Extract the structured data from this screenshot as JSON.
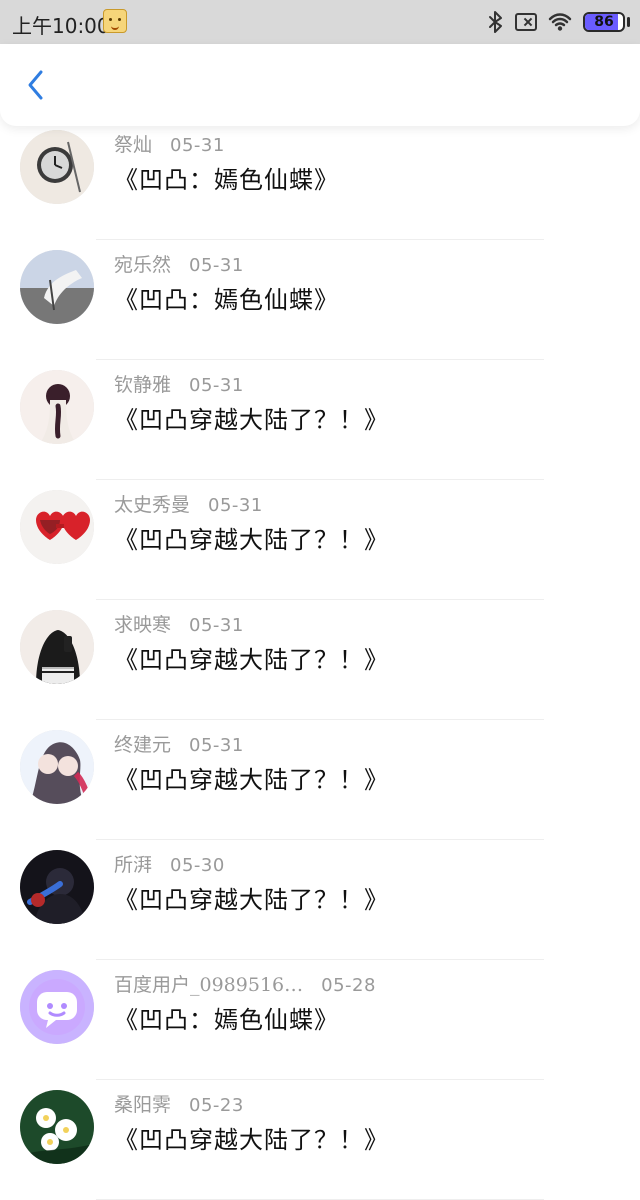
{
  "status_bar": {
    "time": "上午10:00",
    "battery_percent": "86",
    "battery_level": 0.86,
    "colors": {
      "bar_bg": "#d9d9d9",
      "battery_fill": "#6a5cff"
    }
  },
  "header": {
    "back_icon": "chevron-left-icon",
    "accent": "#2f7de1"
  },
  "comments": [
    {
      "name": "祭灿",
      "date": "05-31",
      "title": "《凹凸：嫣色仙蝶》",
      "avatar": "pocket-watch-avatar"
    },
    {
      "name": "宛乐然",
      "date": "05-31",
      "title": "《凹凸：嫣色仙蝶》",
      "avatar": "hand-avatar"
    },
    {
      "name": "钦静雅",
      "date": "05-31",
      "title": "《凹凸穿越大陆了？！》",
      "avatar": "girl-back-avatar"
    },
    {
      "name": "太史秀曼",
      "date": "05-31",
      "title": "《凹凸穿越大陆了？！》",
      "avatar": "heart-glasses-avatar"
    },
    {
      "name": "求映寒",
      "date": "05-31",
      "title": "《凹凸穿越大陆了？！》",
      "avatar": "hoodie-avatar"
    },
    {
      "name": "终建元",
      "date": "05-31",
      "title": "《凹凸穿越大陆了？！》",
      "avatar": "anime-couple-avatar"
    },
    {
      "name": "所湃",
      "date": "05-30",
      "title": "《凹凸穿越大陆了？！》",
      "avatar": "dark-anime-avatar"
    },
    {
      "name": "百度用户_0989516…",
      "date": "05-28",
      "title": "《凹凸：嫣色仙蝶》",
      "avatar": "chat-bubble-avatar"
    },
    {
      "name": "桑阳霁",
      "date": "05-23",
      "title": "《凹凸穿越大陆了？！》",
      "avatar": "flowers-avatar"
    }
  ]
}
